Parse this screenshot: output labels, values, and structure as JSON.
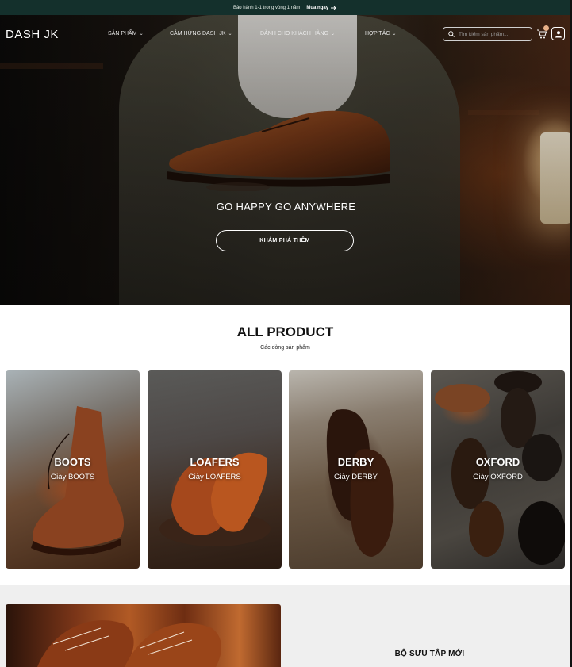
{
  "announcement": {
    "text": "Bảo hành 1-1 trong vòng 1 năm",
    "cta": "Mua ngay"
  },
  "brand": {
    "logo": "DASH JK"
  },
  "nav": {
    "items": [
      {
        "label": "SẢN PHẨM"
      },
      {
        "label": "CẢM HỨNG DASH JK"
      },
      {
        "label": "DÀNH CHO KHÁCH HÀNG"
      },
      {
        "label": "HỢP TÁC"
      }
    ],
    "search_placeholder": "Tìm kiếm sản phẩm...",
    "icons": {
      "search": "search-icon",
      "cart": "cart-icon",
      "user": "user-icon",
      "chevron": "chevron-down-icon"
    }
  },
  "hero": {
    "title": "GO HAPPY GO ANYWHERE",
    "button": "KHÁM PHÁ THÊM"
  },
  "all_product": {
    "title": "ALL PRODUCT",
    "subtitle": "Các dòng sản phẩm",
    "categories": [
      {
        "name": "BOOTS",
        "sub": "Giày BOOTS"
      },
      {
        "name": "LOAFERS",
        "sub": "Giày LOAFERS"
      },
      {
        "name": "DERBY",
        "sub": "Giày DERBY"
      },
      {
        "name": "OXFORD",
        "sub": "Giày OXFORD"
      }
    ]
  },
  "collection": {
    "title": "BỘ SƯU TẬP MỚI"
  },
  "colors": {
    "topbar": "#14302c",
    "accent_badge": "#e8b088"
  }
}
